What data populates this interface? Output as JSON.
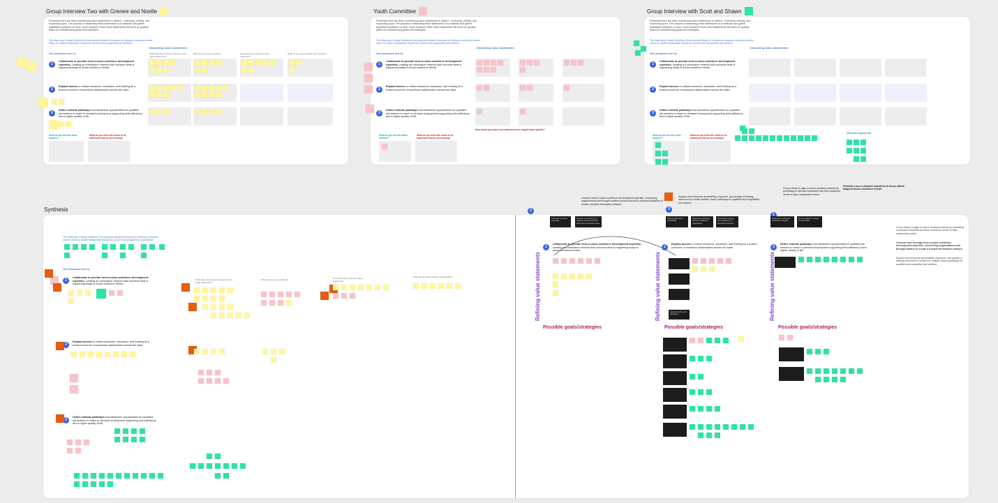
{
  "frames": {
    "interview1": {
      "title": "Group Interview Two with Grenee and Noelle",
      "color": "#fff59b"
    },
    "youth": {
      "title": "Youth Committee",
      "color": "#f7c3c9"
    },
    "interview2": {
      "title": "Group Interview with Scott and Shawn",
      "color": "#2fe2a7"
    },
    "synthesis": {
      "title": "Synthesis"
    }
  },
  "intro": {
    "text": "Presented here are three overarching value statements to dissect - reviewing, refining, and expanding upon. The purpose of dissecting these statements is to evaluate and gather qualitative feedback on each. Once finalized, these value statements will serve as guiding pillars for brainstorming goals and strategies.",
    "mission": "The Maricopa County Workforce Development Board is focused on driving a customer-centric vision to create measurable impact for current and prospective job seekers."
  },
  "labels": {
    "promises": "Our promises are to:",
    "dissecting": "Dissecting value statements",
    "refining_vertical": "Refining value statements",
    "possible_goals": "Possible goals/strategies",
    "alternative": "Alternative approaches",
    "what_do_you_feel": "What do you feel like these address?",
    "what_missing": "What do you think still needs to be addressed that we are missing?",
    "youth_question": "How would you make each statement more targeted and specific?"
  },
  "promises": {
    "p1": {
      "n": "1",
      "bold": "Collaborate to provide best-in-class workforce development expertise,",
      "rest": " creating an information network that connects what is happening today to future workforce trends."
    },
    "p2": {
      "n": "2",
      "bold": "Expand access",
      "rest": " to critical resources, education, and training as a trusted convener of workforce stakeholders across the state."
    },
    "p3": {
      "n": "3",
      "bold": "Define realistic pathways",
      "rest": " that streamline opportunities for qualified job seekers to reach in-demand employment supporting self-sufficiency and a higher quality of life."
    }
  },
  "questions": {
    "q1": "What have been the best aspects of the value statements?",
    "q2": "What do you see as missing?",
    "q3": "How would you refine the value statement?",
    "q4": "What do we need to deliver and prioritize?"
  },
  "synthesis_right": {
    "header1": "Convene best-in-class workforce development expertise, connecting organizations and thought leaders across Arizona in-demand industries to create a trusted information network.",
    "header2": "Support and bring the accessibility, exposure, and quality of training resources to create realistic career pathways for qualified and unqualified job seekers.",
    "header3": "Focus efforts to align to future workforce trends by prioritizing in-demand industries and their workforce needs to take measurable action.",
    "priority": "Prioritize new in-demand industries to focus efforts adapt to future workforce trends.",
    "side_note1": "Focus efforts to align to future workforce trends by prioritizing in-demand industries and their workforce needs to take measurable action.",
    "side_note2": "Convene and leverage best-in-class workforce development expertise, connecting organizations and thought leaders to create a trusted information network.",
    "side_note3": "Support and bring the accessibility, exposure, and quality of training resources to create the realistic career pathways for qualified and unqualified job seekers.",
    "dark1": "Convening trusted expertise",
    "dark2": "Improve connections to create network and build advancing in-demand data",
    "dark3": "Making resources accessible",
    "dark4": "Delivering resources tailored to different populations",
    "dark5": "Developing training and support for in-demand segments",
    "dark6": "Reflecting in-demand industries and jobs",
    "dark7": "Go to workforce experts to help refine",
    "quality": "Quality training and education"
  }
}
